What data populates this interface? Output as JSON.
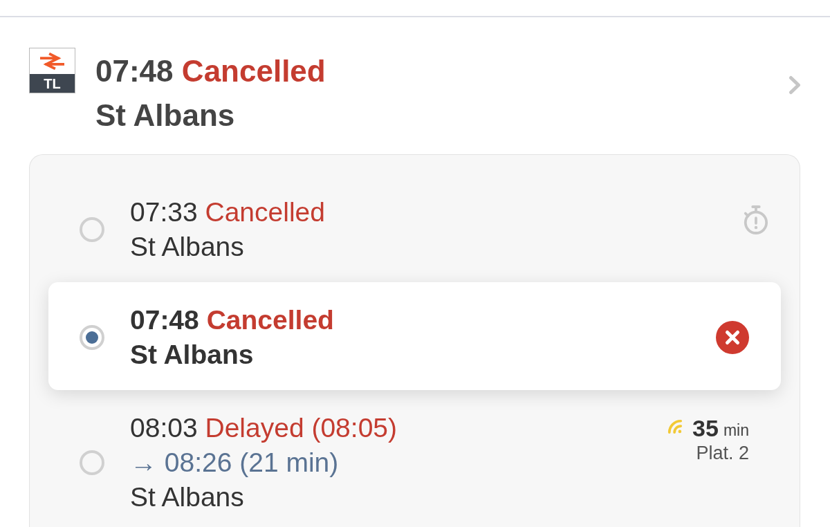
{
  "header": {
    "operator_code": "TL",
    "time": "07:48",
    "status": "Cancelled",
    "destination": "St Albans"
  },
  "options": [
    {
      "kind": "warning",
      "selected": false,
      "time": "07:33",
      "status": "Cancelled",
      "destination": "St Albans"
    },
    {
      "kind": "error",
      "selected": true,
      "time": "07:48",
      "status": "Cancelled",
      "destination": "St Albans"
    },
    {
      "kind": "live",
      "selected": false,
      "time": "08:03",
      "status": "Delayed (08:05)",
      "revised": "→ 08:26 (21 min)",
      "destination": "St Albans",
      "duration": "35",
      "duration_unit": "min",
      "platform": "Plat. 2"
    }
  ]
}
